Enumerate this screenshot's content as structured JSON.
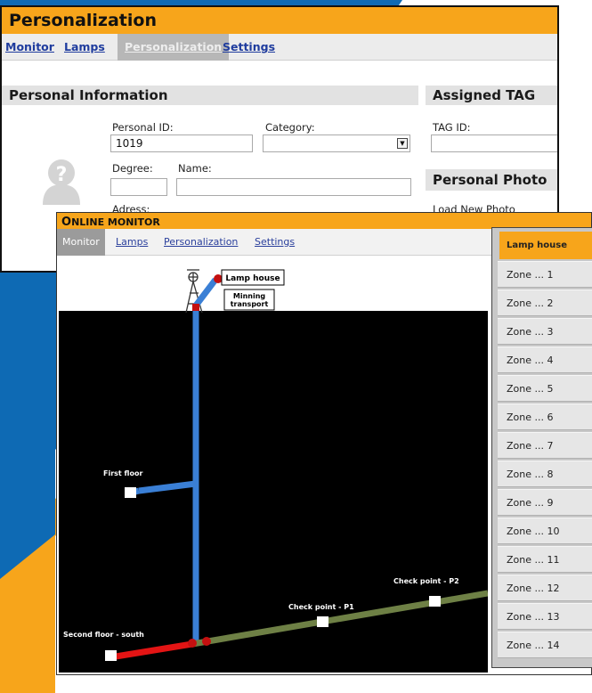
{
  "personalization": {
    "title": "Personalization",
    "tabs": [
      {
        "label": "Monitor",
        "active": false
      },
      {
        "label": "Lamps",
        "active": false
      },
      {
        "label": "Personalization",
        "active": true
      },
      {
        "label": "Settings",
        "active": false
      }
    ],
    "personal_info": {
      "heading": "Personal Information",
      "personal_id_label": "Personal ID:",
      "personal_id_value": "1019",
      "category_label": "Category:",
      "category_value": "",
      "degree_label": "Degree:",
      "degree_value": "",
      "name_label": "Name:",
      "name_value": "",
      "address_label": "Adress:"
    },
    "assigned_tag": {
      "heading": "Assigned TAG",
      "tag_id_label": "TAG ID:",
      "tag_id_value": ""
    },
    "personal_photo": {
      "heading": "Personal Photo",
      "load_label": "Load New Photo"
    }
  },
  "monitor": {
    "title_first": "O",
    "title_rest": "NLINE MONITOR",
    "tabs": [
      {
        "label": "Monitor",
        "active": true
      },
      {
        "label": "Lamps",
        "active": false
      },
      {
        "label": "Personalization",
        "active": false
      },
      {
        "label": "Settings",
        "active": false
      }
    ],
    "map": {
      "lamp_house": "Lamp house",
      "mining_transport_1": "Minning",
      "mining_transport_2": "transport",
      "first_floor": "First floor",
      "second_floor": "Second floor - south",
      "check_p1": "Check point - P1",
      "check_p2": "Check point - P2"
    },
    "zones": {
      "header": "Lamp house",
      "items": [
        "Zone ... 1",
        "Zone ... 2",
        "Zone ... 3",
        "Zone ... 4",
        "Zone ... 5",
        "Zone ... 6",
        "Zone ... 7",
        "Zone ... 8",
        "Zone ... 9",
        "Zone ... 10",
        "Zone ... 11",
        "Zone ... 12",
        "Zone ... 13",
        "Zone ... 14"
      ]
    }
  },
  "colors": {
    "accent_orange": "#f7a51b",
    "background_blue": "#0e6ab4",
    "shaft_blue": "#3a7fd5",
    "tunnel_green": "#6e8045",
    "tunnel_red": "#e31414",
    "node_red": "#c41010"
  }
}
